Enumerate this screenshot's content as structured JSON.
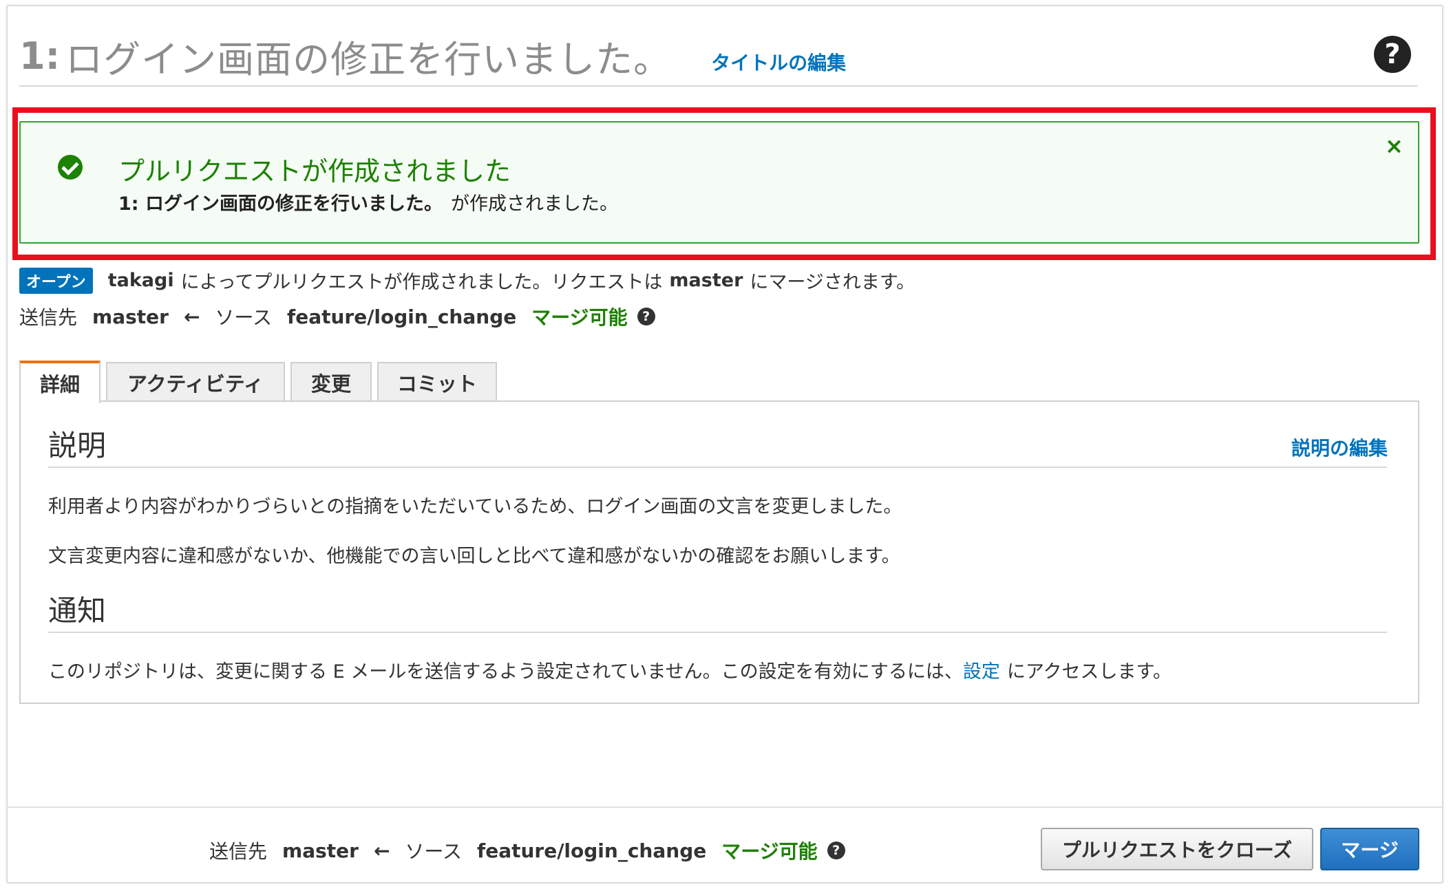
{
  "header": {
    "pr_number": "1:",
    "pr_title": "ログイン画面の修正を行いました。",
    "edit_title_link": "タイトルの編集",
    "help_icon": "?"
  },
  "flash": {
    "title": "プルリクエストが作成されました",
    "body_bold": "1: ログイン画面の修正を行いました。",
    "body_rest": "が作成されました。",
    "close_icon": "×"
  },
  "status": {
    "badge": "オープン",
    "author": "takagi",
    "text1": "によってプルリクエストが作成されました。リクエストは",
    "target": "master",
    "text2": "にマージされます。"
  },
  "branch": {
    "dest_label": "送信先",
    "dest": "master",
    "arrow": "←",
    "source_label": "ソース",
    "source": "feature/login_change",
    "merge_status": "マージ可能",
    "help_icon": "?"
  },
  "tabs": [
    {
      "label": "詳細"
    },
    {
      "label": "アクティビティ"
    },
    {
      "label": "変更"
    },
    {
      "label": "コミット"
    }
  ],
  "details": {
    "description_heading": "説明",
    "description_edit": "説明の編集",
    "description_p1": "利用者より内容がわかりづらいとの指摘をいただいているため、ログイン画面の文言を変更しました。",
    "description_p2": "文言変更内容に違和感がないか、他機能での言い回しと比べて違和感がないかの確認をお願いします。",
    "notify_heading": "通知",
    "notify_text1": "このリポジトリは、変更に関する E メールを送信するよう設定されていません。この設定を有効にするには、",
    "notify_link": "設定",
    "notify_text2": "にアクセスします。"
  },
  "footer": {
    "dest_label": "送信先",
    "dest": "master",
    "arrow": "←",
    "source_label": "ソース",
    "source": "feature/login_change",
    "merge_status": "マージ可能",
    "help_icon": "?",
    "close_button": "プルリクエストをクローズ",
    "merge_button": "マージ"
  },
  "colors": {
    "link": "#0073bb",
    "success": "#1d8102",
    "highlight": "#e8101e",
    "tab_active": "#ec7211",
    "primary_button": "#1f6fbf"
  }
}
